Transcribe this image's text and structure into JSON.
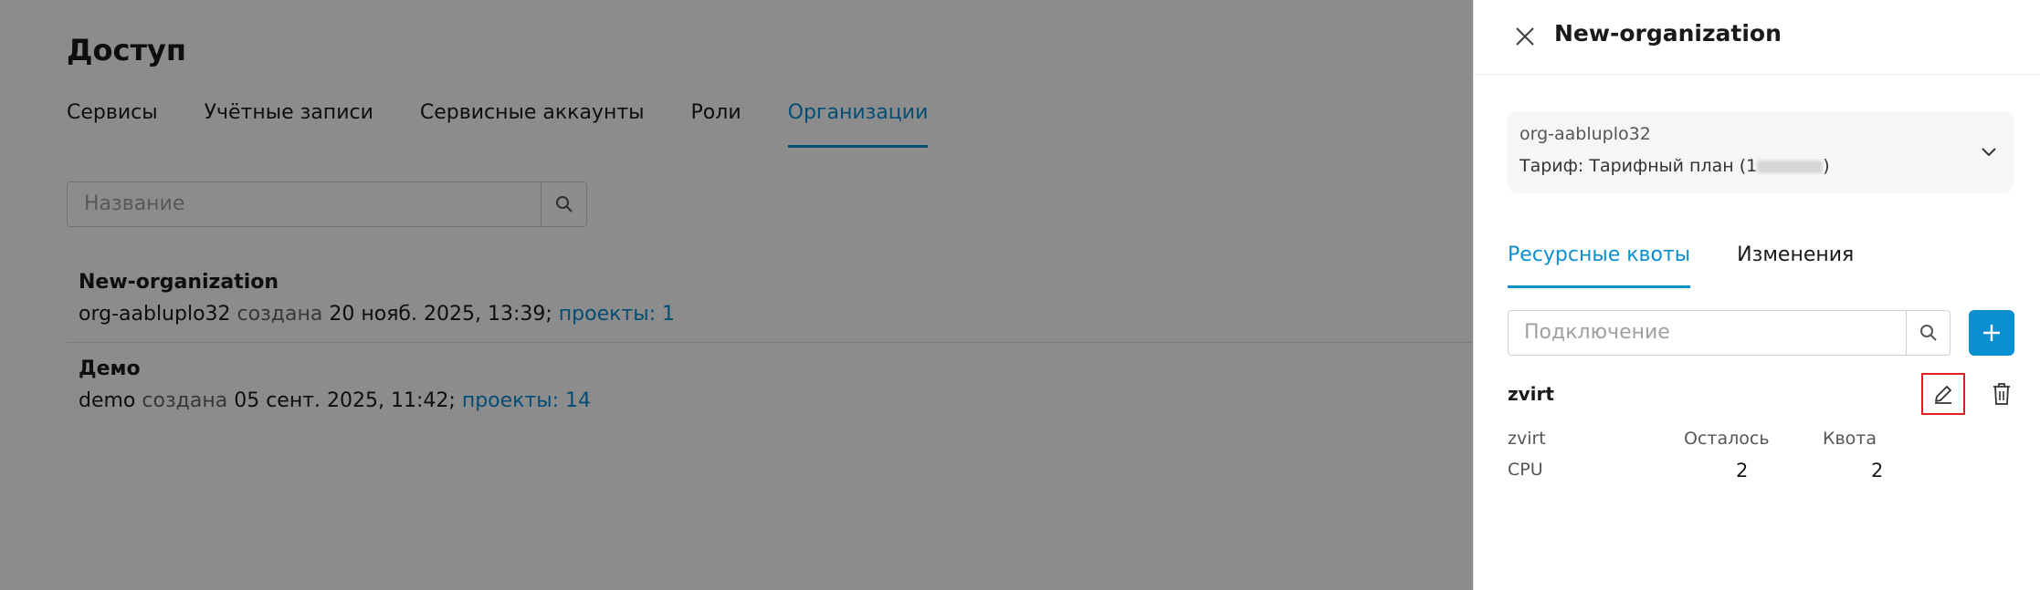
{
  "page": {
    "title": "Доступ",
    "tabs": [
      {
        "label": "Сервисы",
        "active": false
      },
      {
        "label": "Учётные записи",
        "active": false
      },
      {
        "label": "Сервисные аккаунты",
        "active": false
      },
      {
        "label": "Роли",
        "active": false
      },
      {
        "label": "Организации",
        "active": true
      }
    ],
    "search": {
      "placeholder": "Название"
    },
    "organizations": [
      {
        "name": "New-organization",
        "id": "org-aabluplo32",
        "created_label": "создана",
        "created_at": "20 нояб. 2025, 13:39",
        "separator": ";",
        "projects": "проекты: 1"
      },
      {
        "name": "Демо",
        "id": "demo",
        "created_label": "создана",
        "created_at": "05 сент. 2025, 11:42",
        "separator": ";",
        "projects": "проекты: 14"
      }
    ]
  },
  "drawer": {
    "title": "New-organization",
    "info": {
      "id": "org-aabluplo32",
      "plan_prefix": "Тариф: Тарифный план (1",
      "plan_suffix": ")"
    },
    "tabs": [
      {
        "label": "Ресурсные квоты",
        "active": true
      },
      {
        "label": "Изменения",
        "active": false
      }
    ],
    "search": {
      "placeholder": "Подключение"
    },
    "quota": {
      "name": "zvirt",
      "headers": [
        "zvirt",
        "Осталось",
        "Квота"
      ],
      "rows": [
        {
          "resource": "CPU",
          "remaining": "2",
          "quota": "2"
        }
      ]
    }
  },
  "colors": {
    "accent": "#0a8fd1",
    "highlight": "#e02020"
  }
}
